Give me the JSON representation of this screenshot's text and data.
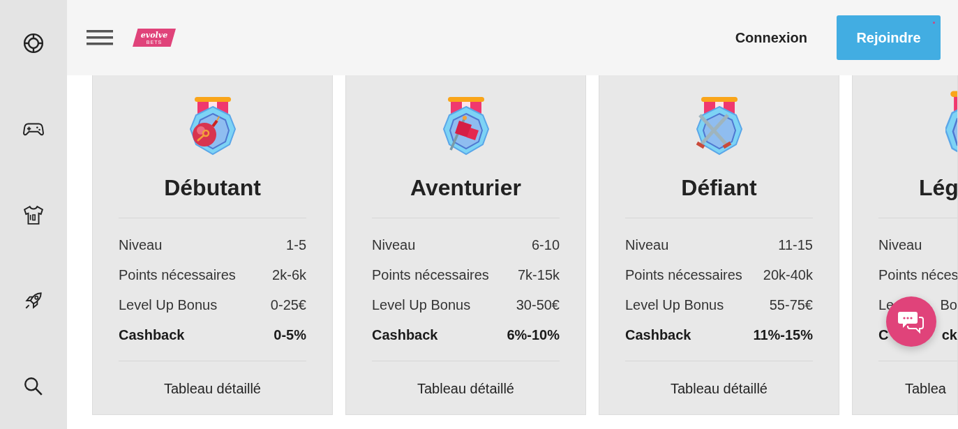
{
  "sidebar": {
    "items": [
      {
        "kind": "lifebuoy"
      },
      {
        "kind": "gamepad"
      },
      {
        "kind": "jersey"
      },
      {
        "kind": "rocket"
      },
      {
        "kind": "search"
      }
    ]
  },
  "header": {
    "logo": {
      "name": "evolve",
      "tagline": "BETS"
    },
    "login": "Connexion",
    "join": {
      "label": "Rejoindre",
      "notification": true
    }
  },
  "tiers": [
    {
      "kind": "bomb",
      "title": "Débutant",
      "rows": [
        {
          "label": "Niveau",
          "value": "1-5",
          "bold": false
        },
        {
          "label": "Points nécessaires",
          "value": "2k-6k",
          "bold": false
        },
        {
          "label": "Level Up Bonus",
          "value": "0-25€",
          "bold": false
        },
        {
          "label": "Cashback",
          "value": "0-5%",
          "bold": true
        }
      ],
      "link": "Tableau détaillé"
    },
    {
      "kind": "flag",
      "title": "Aventurier",
      "rows": [
        {
          "label": "Niveau",
          "value": "6-10",
          "bold": false
        },
        {
          "label": "Points nécessaires",
          "value": "7k-15k",
          "bold": false
        },
        {
          "label": "Level Up Bonus",
          "value": "30-50€",
          "bold": false
        },
        {
          "label": "Cashback",
          "value": "6%-10%",
          "bold": true
        }
      ],
      "link": "Tableau détaillé"
    },
    {
      "kind": "swords",
      "title": "Défiant",
      "rows": [
        {
          "label": "Niveau",
          "value": "11-15",
          "bold": false
        },
        {
          "label": "Points nécessaires",
          "value": "20k-40k",
          "bold": false
        },
        {
          "label": "Level Up Bonus",
          "value": "55-75€",
          "bold": false
        },
        {
          "label": "Cashback",
          "value": "11%-15%",
          "bold": true
        }
      ],
      "link": "Tableau détaillé"
    },
    {
      "kind": "partial",
      "title": "Lég",
      "rows": [
        {
          "label": "Niveau",
          "bold": false
        },
        {
          "label": "Points néces",
          "bold": false
        },
        {
          "label": "Le",
          "label_end": "Bo",
          "bold": false
        },
        {
          "label": "C",
          "label_end": "ck",
          "bold": true
        }
      ],
      "link": "Tablea"
    }
  ],
  "chat": {
    "kind": "chat"
  }
}
